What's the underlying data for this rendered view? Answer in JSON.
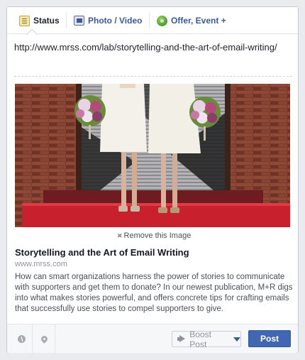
{
  "tabs": [
    {
      "label": "Status",
      "icon": "status-icon",
      "active": true
    },
    {
      "label": "Photo / Video",
      "icon": "photo-video-icon",
      "active": false
    },
    {
      "label": "Offer, Event +",
      "icon": "offer-event-icon",
      "active": false
    }
  ],
  "composer": {
    "url_value": "http://www.mrss.com/lab/storytelling-and-the-art-of-email-writing/"
  },
  "preview": {
    "remove_label": "Remove this Image",
    "title": "Storytelling and the Art of Email Writing",
    "domain": "www.mrss.com",
    "description": "How can smart organizations harness the power of stories to communicate with supporters and get them to donate? In our newest publication, M+R digs into what makes stories powerful, and offers concrete tips for crafting emails that successfully use stories to compel supporters to give."
  },
  "toolbar": {
    "schedule_icon": "clock-icon",
    "location_icon": "location-pin-icon",
    "boost_label": "Boost Post",
    "post_label": "Post"
  },
  "colors": {
    "accent": "#3b5998",
    "post_button": "#4267b2"
  }
}
